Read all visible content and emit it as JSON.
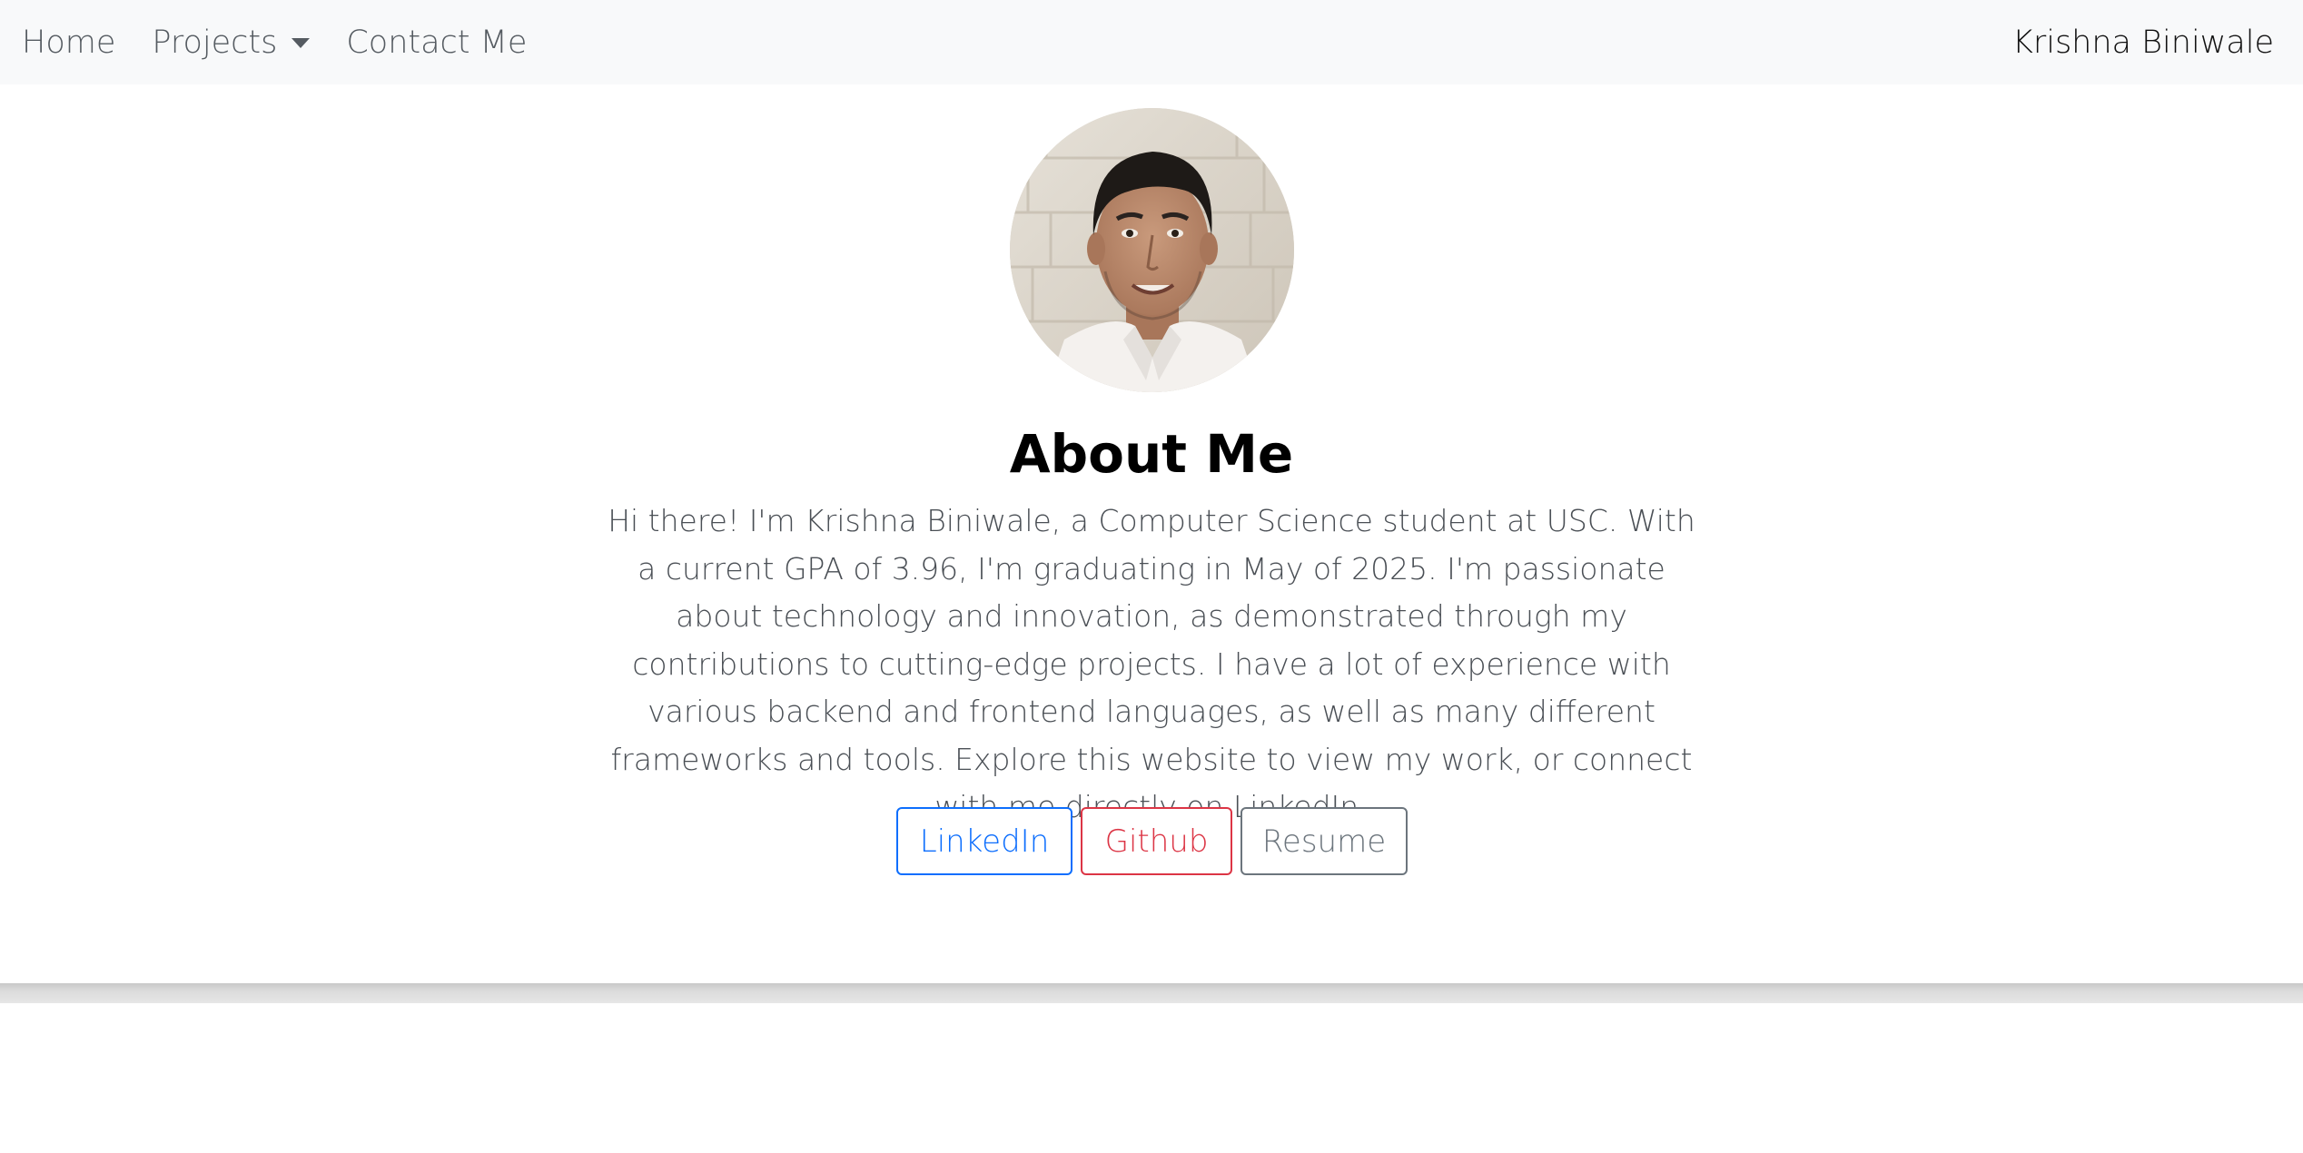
{
  "nav": {
    "items": [
      {
        "label": "Home"
      },
      {
        "label": "Projects"
      },
      {
        "label": "Contact Me"
      }
    ],
    "brand": "Krishna Biniwale"
  },
  "profile": {
    "photo_alt": "Profile photo of Krishna Biniwale"
  },
  "about": {
    "title": "About Me",
    "bio": "Hi there! I'm Krishna Biniwale, a Computer Science student at USC. With a current GPA of 3.96, I'm graduating in May of 2025. I'm passionate about technology and innovation, as demonstrated through my contributions to cutting-edge projects. I have a lot of experience with various backend and frontend languages, as well as many different frameworks and tools. Explore this website to view my work, or connect with me directly on LinkedIn."
  },
  "buttons": {
    "linkedin": "LinkedIn",
    "github": "Github",
    "resume": "Resume"
  },
  "colors": {
    "navbar_bg": "#f8f9fa",
    "linkedin": "#0d6efd",
    "github": "#dc3545",
    "resume": "#6c757d"
  }
}
